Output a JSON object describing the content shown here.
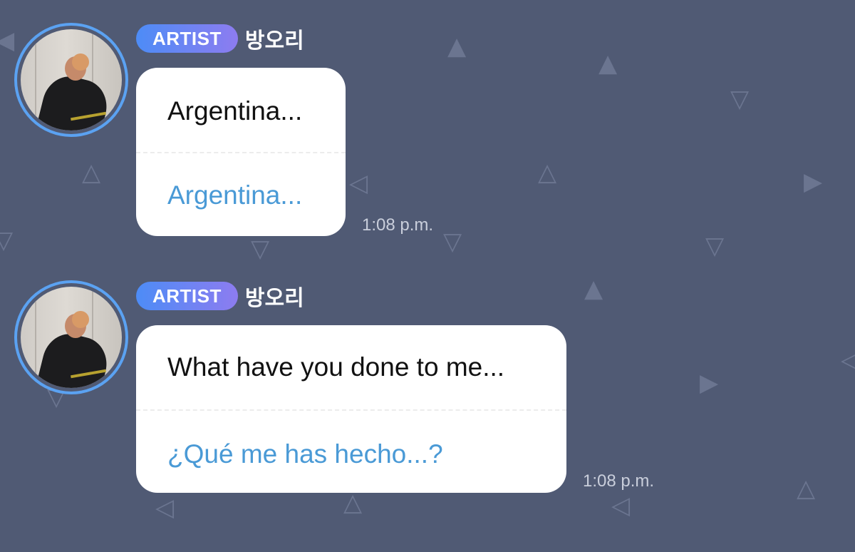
{
  "messages": [
    {
      "badge": "ARTIST",
      "username": "방오리",
      "original": "Argentina...",
      "translation": "Argentina...",
      "time": "1:08 p.m."
    },
    {
      "badge": "ARTIST",
      "username": "방오리",
      "original": "What have you done to me...",
      "translation": "¿Qué me has hecho...?",
      "time": "1:08 p.m."
    }
  ],
  "colors": {
    "background": "#505a74",
    "badge_gradient_start": "#4d8cf6",
    "badge_gradient_end": "#8d7cf0",
    "translation_text": "#4a9ad6",
    "avatar_ring": "#5ba2f2"
  },
  "icons": {
    "background_pattern": "triangle-pattern-icon"
  }
}
